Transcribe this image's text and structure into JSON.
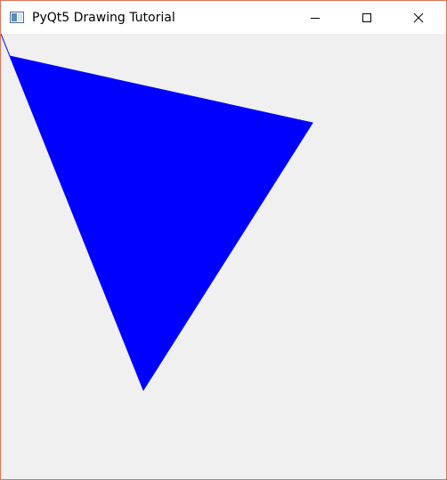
{
  "window": {
    "title": "PyQt5 Drawing Tutorial",
    "icon": "window-app-icon",
    "controls": {
      "minimize": "minimize-icon",
      "maximize": "maximize-icon",
      "close": "close-icon"
    }
  },
  "canvas": {
    "background_color": "#f0f0f0",
    "shape": {
      "type": "triangle",
      "fill_color": "#0000ff",
      "stroke_color": "#0000ff"
    }
  }
}
